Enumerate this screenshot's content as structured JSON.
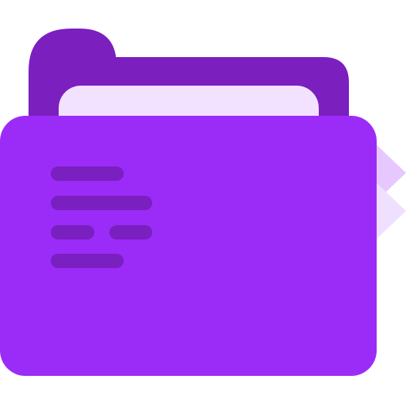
{
  "icon": {
    "name": "folder-icon",
    "colors": {
      "tab": "#7B1FBF",
      "paper_inner": "#F3E2FF",
      "folder_front": "#9B2CF8",
      "text_lines": "#7A1FC0",
      "side_paper_1": "#E6C8FF",
      "side_paper_2": "#F0E0FF"
    }
  }
}
